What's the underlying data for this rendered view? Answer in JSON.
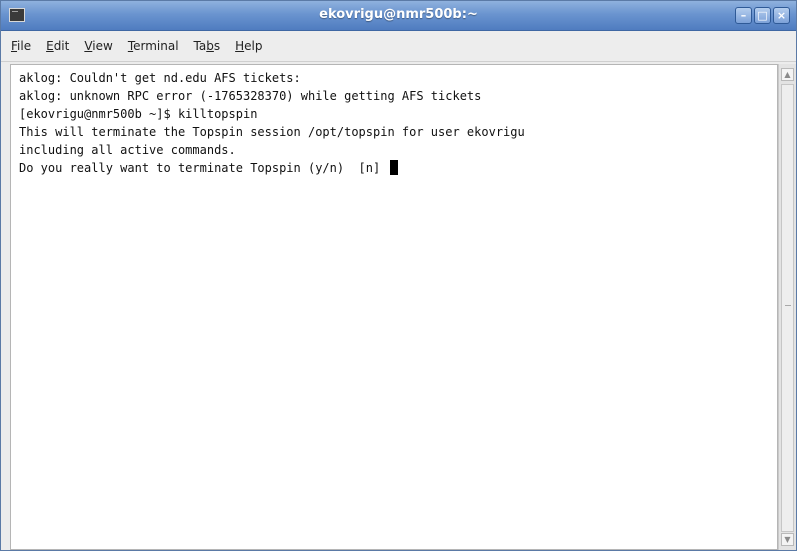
{
  "window": {
    "title": "ekovrigu@nmr500b:~",
    "icon": "terminal-icon",
    "controls": {
      "minimize": "–",
      "maximize": "□",
      "close": "×"
    }
  },
  "menu": [
    {
      "mnemonic": "F",
      "rest": "ile"
    },
    {
      "mnemonic": "E",
      "rest": "dit"
    },
    {
      "mnemonic": "V",
      "rest": "iew"
    },
    {
      "mnemonic": "T",
      "rest": "erminal"
    },
    {
      "pre": "Ta",
      "mnemonic": "b",
      "rest": "s"
    },
    {
      "mnemonic": "H",
      "rest": "elp"
    }
  ],
  "terminal": {
    "lines": [
      "aklog: Couldn't get nd.edu AFS tickets:",
      "aklog: unknown RPC error (-1765328370) while getting AFS tickets",
      "[ekovrigu@nmr500b ~]$ killtopspin",
      "This will terminate the Topspin session /opt/topspin for user ekovrigu",
      "including all active commands.",
      "Do you really want to terminate Topspin (y/n)  [n]"
    ]
  },
  "scrollbar": {
    "up_arrow": "▲",
    "down_arrow": "▼"
  }
}
